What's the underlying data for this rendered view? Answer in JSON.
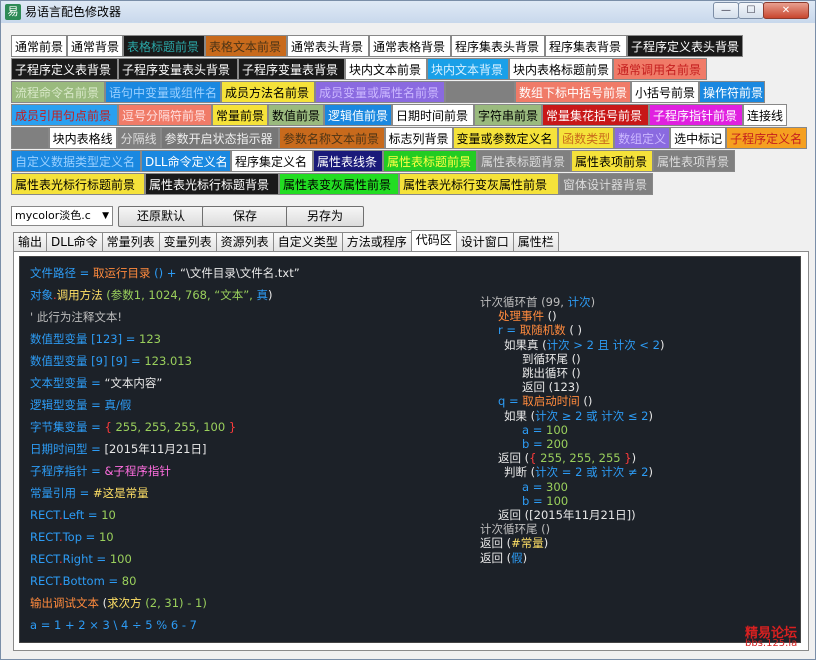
{
  "window": {
    "title": "易语言配色修改器",
    "min_label": "—",
    "max_label": "☐",
    "close_label": "✕"
  },
  "swatches": [
    [
      {
        "label": "通常前景",
        "bg": "#ffffff",
        "fg": "#000000",
        "w": 56
      },
      {
        "label": "通常背景",
        "bg": "#ffffff",
        "fg": "#000000",
        "w": 56
      },
      {
        "label": "表格标题前景",
        "bg": "#1a1a1a",
        "fg": "#2aa6a6",
        "w": 82
      },
      {
        "label": "表格文本前景",
        "bg": "#c86a1c",
        "fg": "#4e3516",
        "w": 82
      },
      {
        "label": "通常表头背景",
        "bg": "#ffffff",
        "fg": "#000000",
        "w": 82
      },
      {
        "label": "通常表格背景",
        "bg": "#ffffff",
        "fg": "#000000",
        "w": 82
      },
      {
        "label": "程序集表头背景",
        "bg": "#ffffff",
        "fg": "#000000",
        "w": 94
      },
      {
        "label": "程序集表背景",
        "bg": "#ffffff",
        "fg": "#000000",
        "w": 82
      },
      {
        "label": "子程序定义表头背景",
        "bg": "#1a1a1a",
        "fg": "#ffffff",
        "w": 116
      }
    ],
    [
      {
        "label": "子程序定义表背景",
        "bg": "#1a1a1a",
        "fg": "#ffffff",
        "w": 107
      },
      {
        "label": "子程序变量表头背景",
        "bg": "#1a1a1a",
        "fg": "#ffffff",
        "w": 120
      },
      {
        "label": "子程序变量表背景",
        "bg": "#1a1a1a",
        "fg": "#ffffff",
        "w": 107
      },
      {
        "label": "块内文本前景",
        "bg": "#ffffff",
        "fg": "#000000",
        "w": 82
      },
      {
        "label": "块内文本背景",
        "bg": "#1aa0e8",
        "fg": "#d8f0ff",
        "w": 82
      },
      {
        "label": "块内表格标题前景",
        "bg": "#ffffff",
        "fg": "#000000",
        "w": 104
      },
      {
        "label": "通常调用名前景",
        "bg": "#f07b68",
        "fg": "#c41e1e",
        "w": 94
      }
    ],
    [
      {
        "label": "流程命令名前景",
        "bg": "#9aba7e",
        "fg": "#d8e8c8",
        "w": 94
      },
      {
        "label": "语句中变量或组件名",
        "bg": "#1a88e0",
        "fg": "#9ad0ff",
        "w": 116
      },
      {
        "label": "成员方法名前景",
        "bg": "#f5e23a",
        "fg": "#000000",
        "w": 94
      },
      {
        "label": "成员变量或属性名前景",
        "bg": "#8a6ae0",
        "fg": "#ccb8ff",
        "w": 130
      },
      {
        "label": "",
        "bg": "#808080",
        "fg": "#808080",
        "w": 70
      },
      {
        "label": "数组下标中括号前景",
        "bg": "#f07b68",
        "fg": "#ffffff",
        "w": 116
      },
      {
        "label": "小括号前景",
        "bg": "#ffffff",
        "fg": "#000000",
        "w": 68
      },
      {
        "label": "操作符前景",
        "bg": "#1a88e0",
        "fg": "#ffffff",
        "w": 66
      }
    ],
    [
      {
        "label": "成员引用句点前景",
        "bg": "#2aa0f0",
        "fg": "#c41e1e",
        "w": 107
      },
      {
        "label": "逗号分隔符前景",
        "bg": "#f07b68",
        "fg": "#ffe0e0",
        "w": 94
      },
      {
        "label": "常量前景",
        "bg": "#f5e23a",
        "fg": "#000000",
        "w": 56
      },
      {
        "label": "数值前景",
        "bg": "#9aba7e",
        "fg": "#000000",
        "w": 56
      },
      {
        "label": "逻辑值前景",
        "bg": "#1a88e0",
        "fg": "#ffffff",
        "w": 68
      },
      {
        "label": "日期时间前景",
        "bg": "#ffffff",
        "fg": "#000000",
        "w": 82
      },
      {
        "label": "字符串前景",
        "bg": "#9aba7e",
        "fg": "#000000",
        "w": 68
      },
      {
        "label": "常量集花括号前景",
        "bg": "#c81818",
        "fg": "#ffffff",
        "w": 107
      },
      {
        "label": "子程序指针前景",
        "bg": "#e020e0",
        "fg": "#ffffff",
        "w": 94
      },
      {
        "label": "连接线",
        "bg": "#ffffff",
        "fg": "#000000",
        "w": 44
      }
    ],
    [
      {
        "label": "",
        "bg": "#808080",
        "fg": "#808080",
        "w": 38
      },
      {
        "label": "块内表格线",
        "bg": "#ffffff",
        "fg": "#000000",
        "w": 68
      },
      {
        "label": "分隔线",
        "bg": "#808080",
        "fg": "#dcdcdc",
        "w": 44
      },
      {
        "label": "参数开启状态指示器",
        "bg": "#777777",
        "fg": "#eeeeee",
        "w": 120
      },
      {
        "label": "参数名称文本前景",
        "bg": "#c86a1c",
        "fg": "#4e3516",
        "w": 107
      },
      {
        "label": "标志列背景",
        "bg": "#ffffff",
        "fg": "#000000",
        "w": 68
      },
      {
        "label": "变量或参数定义名",
        "bg": "#f5e23a",
        "fg": "#000000",
        "w": 107
      },
      {
        "label": "函数类型",
        "bg": "#f5e23a",
        "fg": "#c86a1c",
        "w": 56
      },
      {
        "label": "数组定义",
        "bg": "#8a6ae0",
        "fg": "#ccb8ff",
        "w": 56
      },
      {
        "label": "选中标记",
        "bg": "#ffffff",
        "fg": "#000000",
        "w": 56
      },
      {
        "label": "子程序定义名",
        "bg": "#f5a020",
        "fg": "#c41e1e",
        "w": 82
      }
    ],
    [
      {
        "label": "自定义数据类型定义名",
        "bg": "#1a88e0",
        "fg": "#9ad0ff",
        "w": 130
      },
      {
        "label": "DLL命令定义名",
        "bg": "#1a88e0",
        "fg": "#ffffff",
        "w": 90
      },
      {
        "label": "程序集定义名",
        "bg": "#ffffff",
        "fg": "#000000",
        "w": 82
      },
      {
        "label": "属性表线条",
        "bg": "#1a1a7a",
        "fg": "#ffffff",
        "w": 70
      },
      {
        "label": "属性表标题前景",
        "bg": "#22cc22",
        "fg": "#ffff44",
        "w": 94
      },
      {
        "label": "属性表标题背景",
        "bg": "#808080",
        "fg": "#dcdcdc",
        "w": 94
      },
      {
        "label": "属性表项前景",
        "bg": "#f5e23a",
        "fg": "#000000",
        "w": 82
      },
      {
        "label": "属性表项背景",
        "bg": "#808080",
        "fg": "#dcdcdc",
        "w": 82
      }
    ],
    [
      {
        "label": "属性表光标行标题前景",
        "bg": "#f5e23a",
        "fg": "#000000",
        "w": 134
      },
      {
        "label": "属性表光标行标题背景",
        "bg": "#1a1a1a",
        "fg": "#ffffff",
        "w": 134
      },
      {
        "label": "属性表变灰属性前景",
        "bg": "#22dd22",
        "fg": "#000000",
        "w": 120
      },
      {
        "label": "属性表光标行变灰属性前景",
        "bg": "#f5e23a",
        "fg": "#000000",
        "w": 160
      },
      {
        "label": "窗体设计器背景",
        "bg": "#808080",
        "fg": "#dcdcdc",
        "w": 94
      }
    ]
  ],
  "controls": {
    "combo_value": "mycolor淡色.c",
    "reset": "还原默认",
    "save": "保存",
    "save_as": "另存为"
  },
  "tabs": [
    "输出",
    "DLL命令",
    "常量列表",
    "变量列表",
    "资源列表",
    "自定义类型",
    "方法或程序",
    "代码区",
    "设计窗口",
    "属性栏"
  ],
  "active_tab": "代码区",
  "code_left": [
    [
      {
        "t": "文件路径 = ",
        "c": "k"
      },
      {
        "t": "取运行目录",
        "c": "o"
      },
      {
        "t": " () + ",
        "c": "k"
      },
      {
        "t": "“\\文件目录\\文件名.txt”",
        "c": "w"
      }
    ],
    [
      {
        "t": "对象",
        "c": "k"
      },
      {
        "t": ".",
        "c": "r"
      },
      {
        "t": "调用方法",
        "c": "y"
      },
      {
        "t": " (参数1, 1024, 768, “文本”, ",
        "c": "g"
      },
      {
        "t": "真",
        "c": "k"
      },
      {
        "t": ")",
        "c": "w"
      }
    ],
    [
      {
        "t": "' 此行为注释文本!",
        "c": "c"
      }
    ],
    [
      {
        "t": "数值型变量 [123] = ",
        "c": "k"
      },
      {
        "t": "123",
        "c": "g"
      }
    ],
    [
      {
        "t": "数值型变量 [9] [9] = ",
        "c": "k"
      },
      {
        "t": "123.013",
        "c": "g"
      }
    ],
    [
      {
        "t": "文本型变量 = ",
        "c": "k"
      },
      {
        "t": "“文本内容”",
        "c": "w"
      }
    ],
    [
      {
        "t": "逻辑型变量 = ",
        "c": "k"
      },
      {
        "t": "真/假",
        "c": "k"
      }
    ],
    [
      {
        "t": "字节集变量 = ",
        "c": "k"
      },
      {
        "t": "{ ",
        "c": "r"
      },
      {
        "t": "255, 255, 255, 100",
        "c": "g"
      },
      {
        "t": " }",
        "c": "r"
      }
    ],
    [
      {
        "t": "日期时间型 = ",
        "c": "k"
      },
      {
        "t": "[2015年11月21日]",
        "c": "w"
      }
    ],
    [
      {
        "t": "子程序指针 = ",
        "c": "k"
      },
      {
        "t": "&子程序指针",
        "c": "p"
      }
    ],
    [
      {
        "t": "常量引用 = ",
        "c": "k"
      },
      {
        "t": "#这是常量",
        "c": "y"
      }
    ],
    [
      {
        "t": "RECT",
        "c": "k"
      },
      {
        "t": ".",
        "c": "r"
      },
      {
        "t": "Left = ",
        "c": "k"
      },
      {
        "t": "10",
        "c": "g"
      }
    ],
    [
      {
        "t": "RECT",
        "c": "k"
      },
      {
        "t": ".",
        "c": "r"
      },
      {
        "t": "Top = ",
        "c": "k"
      },
      {
        "t": "10",
        "c": "g"
      }
    ],
    [
      {
        "t": "RECT",
        "c": "k"
      },
      {
        "t": ".",
        "c": "r"
      },
      {
        "t": "Right = ",
        "c": "k"
      },
      {
        "t": "100",
        "c": "g"
      }
    ],
    [
      {
        "t": "RECT",
        "c": "k"
      },
      {
        "t": ".",
        "c": "r"
      },
      {
        "t": "Bottom = ",
        "c": "k"
      },
      {
        "t": "80",
        "c": "g"
      }
    ],
    [
      {
        "t": "输出调试文本",
        "c": "o"
      },
      {
        "t": " (",
        "c": "w"
      },
      {
        "t": "求次方",
        "c": "y"
      },
      {
        "t": " (2, 31) - 1)",
        "c": "g"
      }
    ],
    [
      {
        "t": "a = 1 + 2 × 3 \\ 4 ÷ 5 % 6 - 7",
        "c": "k"
      }
    ]
  ],
  "code_right": [
    {
      "x": 0,
      "parts": [
        {
          "t": "计次循环首 (99, ",
          "c": "dim"
        },
        {
          "t": "计次",
          "c": "k"
        },
        {
          "t": ")",
          "c": "dim"
        }
      ]
    },
    {
      "x": 18,
      "parts": [
        {
          "t": "处理事件",
          "c": "o"
        },
        {
          "t": " ()",
          "c": "w"
        }
      ]
    },
    {
      "x": 18,
      "parts": [
        {
          "t": "r = ",
          "c": "k"
        },
        {
          "t": "取随机数",
          "c": "o"
        },
        {
          "t": " ( )",
          "c": "w"
        }
      ]
    },
    {
      "x": 24,
      "parts": [
        {
          "t": "如果真 (",
          "c": "w"
        },
        {
          "t": "计次 > 2 且 计次 < 2",
          "c": "k"
        },
        {
          "t": ")",
          "c": "w"
        }
      ]
    },
    {
      "x": 42,
      "parts": [
        {
          "t": "到循环尾 ()",
          "c": "w"
        }
      ]
    },
    {
      "x": 42,
      "parts": [
        {
          "t": "跳出循环 ()",
          "c": "w"
        }
      ]
    },
    {
      "x": 42,
      "parts": [
        {
          "t": "返回 (123)",
          "c": "w"
        }
      ]
    },
    {
      "x": 18,
      "parts": [
        {
          "t": "q = ",
          "c": "k"
        },
        {
          "t": "取启动时间",
          "c": "o"
        },
        {
          "t": " ()",
          "c": "w"
        }
      ]
    },
    {
      "x": 24,
      "parts": [
        {
          "t": "如果 (",
          "c": "w"
        },
        {
          "t": "计次 ≥ 2 或 计次 ≤ 2",
          "c": "k"
        },
        {
          "t": ")",
          "c": "w"
        }
      ]
    },
    {
      "x": 42,
      "parts": [
        {
          "t": "a = ",
          "c": "k"
        },
        {
          "t": "100",
          "c": "g"
        }
      ]
    },
    {
      "x": 42,
      "parts": [
        {
          "t": "b = ",
          "c": "k"
        },
        {
          "t": "200",
          "c": "g"
        }
      ]
    },
    {
      "x": 18,
      "parts": [
        {
          "t": "返回 (",
          "c": "w"
        },
        {
          "t": "{ ",
          "c": "r"
        },
        {
          "t": "255, 255, 255",
          "c": "g"
        },
        {
          "t": " }",
          "c": "r"
        },
        {
          "t": ")",
          "c": "w"
        }
      ]
    },
    {
      "x": 24,
      "parts": [
        {
          "t": "判断 (",
          "c": "w"
        },
        {
          "t": "计次 = 2 或 计次 ≠ 2",
          "c": "k"
        },
        {
          "t": ")",
          "c": "w"
        }
      ]
    },
    {
      "x": 42,
      "parts": [
        {
          "t": "a = ",
          "c": "k"
        },
        {
          "t": "300",
          "c": "g"
        }
      ]
    },
    {
      "x": 42,
      "parts": [
        {
          "t": "b = ",
          "c": "k"
        },
        {
          "t": "100",
          "c": "g"
        }
      ]
    },
    {
      "x": 18,
      "parts": [
        {
          "t": "返回 ([2015年11月21日])",
          "c": "w"
        }
      ]
    },
    {
      "x": 0,
      "parts": [
        {
          "t": "计次循环尾 ()",
          "c": "dim"
        }
      ]
    },
    {
      "x": 0,
      "parts": [
        {
          "t": "返回 (",
          "c": "w"
        },
        {
          "t": "#常量",
          "c": "y"
        },
        {
          "t": ")",
          "c": "w"
        }
      ]
    },
    {
      "x": 0,
      "parts": [
        {
          "t": "返回 (",
          "c": "w"
        },
        {
          "t": "假",
          "c": "k"
        },
        {
          "t": ")",
          "c": "w"
        }
      ]
    }
  ],
  "watermark": {
    "name": "精易论坛",
    "url": "bbs.125.la"
  }
}
